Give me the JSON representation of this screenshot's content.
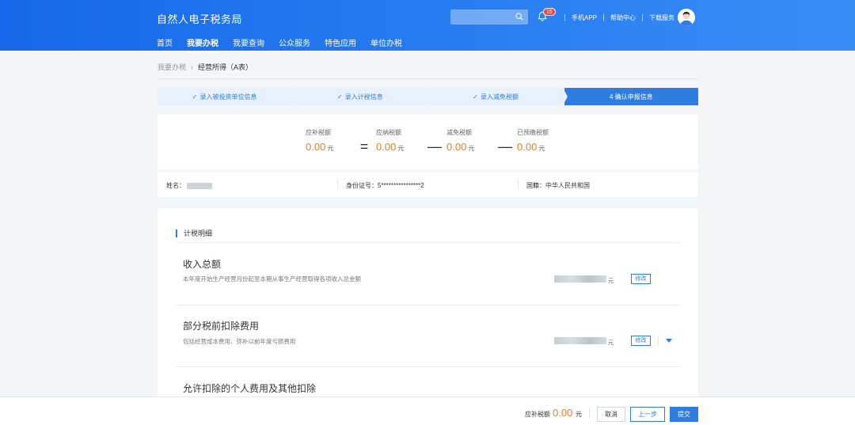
{
  "header": {
    "title": "自然人电子税务局",
    "nav": [
      "首页",
      "我要办税",
      "我要查询",
      "公众服务",
      "特色应用",
      "单位办税"
    ],
    "active_nav": "我要办税",
    "notification_count": "15",
    "links": [
      "手机APP",
      "帮助中心",
      "下载服务"
    ],
    "search_placeholder": ""
  },
  "breadcrumb": {
    "parent": "我要办税",
    "separator": "›",
    "current": "经营所得（A表）"
  },
  "steps": [
    {
      "label": "录入被投资单位信息",
      "done": true
    },
    {
      "label": "录入计税信息",
      "done": true
    },
    {
      "label": "录入减免税额",
      "done": true
    },
    {
      "label": "4 确认申报信息",
      "done": false,
      "active": true
    }
  ],
  "summary": {
    "items": [
      {
        "label": "应补税额",
        "value": "0.00",
        "unit": "元"
      },
      {
        "label": "应纳税额",
        "value": "0.00",
        "unit": "元"
      },
      {
        "label": "减免税额",
        "value": "0.00",
        "unit": "元"
      },
      {
        "label": "已预缴税额",
        "value": "0.00",
        "unit": "元"
      }
    ],
    "operators": [
      "=",
      "—",
      "—"
    ]
  },
  "info": {
    "name_label": "姓名：",
    "id_label": "身份证号：",
    "id_value": "5****************2",
    "nation_label": "国籍：",
    "nation_value": "中华人民共和国"
  },
  "detail": {
    "title": "计税明细",
    "items": [
      {
        "title": "收入总额",
        "desc": "本年度开始生产经营月份起至本期从事生产经营取得各项收入总金额",
        "unit": "元",
        "edit": "修改"
      },
      {
        "title": "部分税前扣除费用",
        "desc": "包括经营成本费用、弥补以前年度亏损费用",
        "unit": "元",
        "edit": "修改"
      },
      {
        "title": "允许扣除的个人费用及其他扣除",
        "desc": "",
        "unit": "",
        "edit": ""
      }
    ]
  },
  "footer": {
    "label": "应补税额",
    "value": "0.00",
    "unit": "元",
    "cancel": "取消",
    "prev": "上一步",
    "submit": "提交"
  },
  "colors": {
    "primary": "#2f7de1",
    "header_from": "#1668e8",
    "amount": "#f07e1a"
  }
}
